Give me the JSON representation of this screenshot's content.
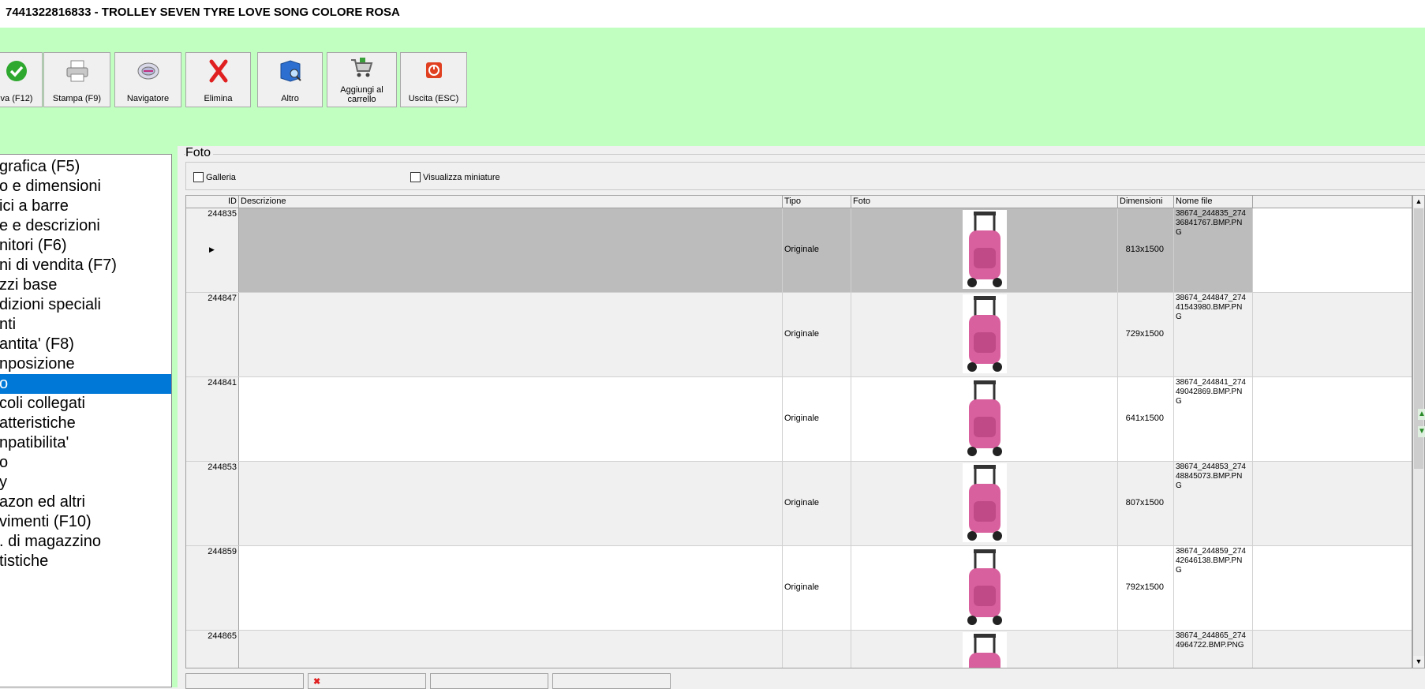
{
  "window": {
    "title": "7441322816833 - TROLLEY SEVEN TYRE LOVE SONG COLORE ROSA"
  },
  "toolbar": {
    "buttons": [
      {
        "label": "va (F12)",
        "icon": "check-icon"
      },
      {
        "label": "Stampa (F9)",
        "icon": "printer-icon"
      },
      {
        "label": "Navigatore",
        "icon": "compass-icon"
      },
      {
        "label": "Elimina",
        "icon": "delete-x-icon"
      },
      {
        "label": "Altro",
        "icon": "book-search-icon"
      },
      {
        "label": "Aggiungi al carrello",
        "icon": "cart-icon"
      },
      {
        "label": "Uscita (ESC)",
        "icon": "power-icon"
      }
    ]
  },
  "nav": {
    "items": [
      "grafica (F5)",
      "o e dimensioni",
      "ici a barre",
      "e e descrizioni",
      "nitori (F6)",
      "ni di vendita (F7)",
      "zzi base",
      "dizioni speciali",
      "nti",
      "antita' (F8)",
      "nposizione",
      "o",
      "coli collegati",
      "atteristiche",
      "npatibilita'",
      "o",
      "y",
      "azon ed altri",
      "vimenti (F10)",
      ". di magazzino",
      "tistiche"
    ],
    "selected_index": 11
  },
  "foto": {
    "group_title": "Foto",
    "galleria_label": "Galleria",
    "miniature_label": "Visualizza miniature",
    "columns": [
      "ID",
      "Descrizione",
      "Tipo",
      "Foto",
      "Dimensioni",
      "Nome file"
    ],
    "rows": [
      {
        "id": "244835",
        "descrizione": "",
        "tipo": "Originale",
        "dimensioni": "813x1500",
        "nome_file": "38674_244835_27436841767.BMP.PNG"
      },
      {
        "id": "244847",
        "descrizione": "",
        "tipo": "Originale",
        "dimensioni": "729x1500",
        "nome_file": "38674_244847_27441543980.BMP.PNG"
      },
      {
        "id": "244841",
        "descrizione": "",
        "tipo": "Originale",
        "dimensioni": "641x1500",
        "nome_file": "38674_244841_27449042869.BMP.PNG"
      },
      {
        "id": "244853",
        "descrizione": "",
        "tipo": "Originale",
        "dimensioni": "807x1500",
        "nome_file": "38674_244853_27448845073.BMP.PNG"
      },
      {
        "id": "244859",
        "descrizione": "",
        "tipo": "Originale",
        "dimensioni": "792x1500",
        "nome_file": "38674_244859_27442646138.BMP.PNG"
      },
      {
        "id": "244865",
        "descrizione": "",
        "tipo": "",
        "dimensioni": "",
        "nome_file": "38674_244865_2744964722.BMP.PNG"
      }
    ]
  },
  "colors": {
    "toolbar_bg": "#c0ffc0",
    "selection": "#0078d7",
    "trolley_pink": "#d9609e"
  }
}
